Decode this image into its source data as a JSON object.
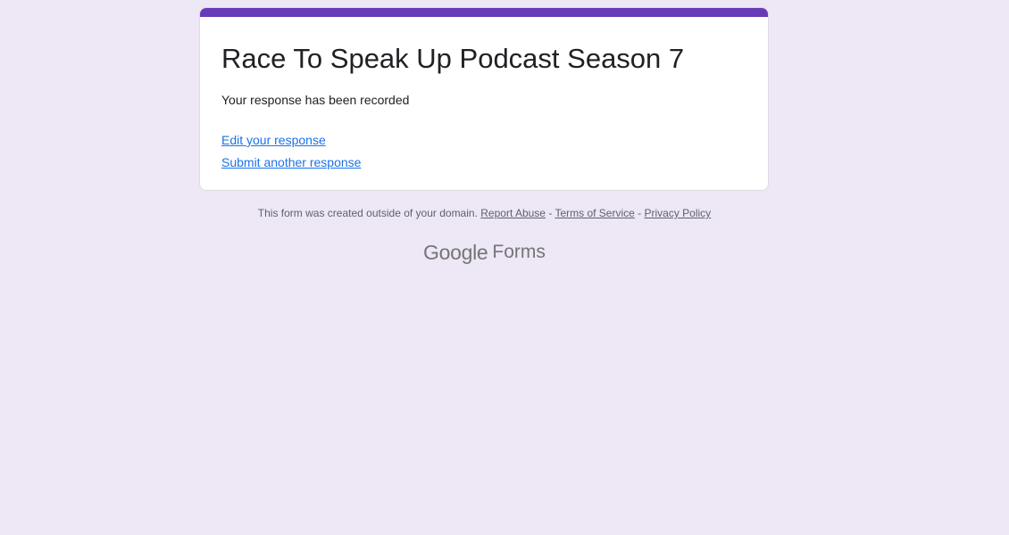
{
  "form": {
    "title": "Race To Speak Up Podcast Season 7",
    "confirmation": "Your response has been recorded",
    "edit_link": "Edit your response",
    "another_link": "Submit another response",
    "accent_color": "#673ab7"
  },
  "footer": {
    "notice": "This form was created outside of your domain.",
    "report_abuse": "Report Abuse",
    "separator": "-",
    "terms": "Terms of Service",
    "privacy": "Privacy Policy"
  },
  "brand": {
    "google": "Google",
    "forms": "Forms"
  },
  "colors": {
    "background": "#ede7f6",
    "link": "#1a73e8",
    "footer_text": "#5f6368"
  }
}
